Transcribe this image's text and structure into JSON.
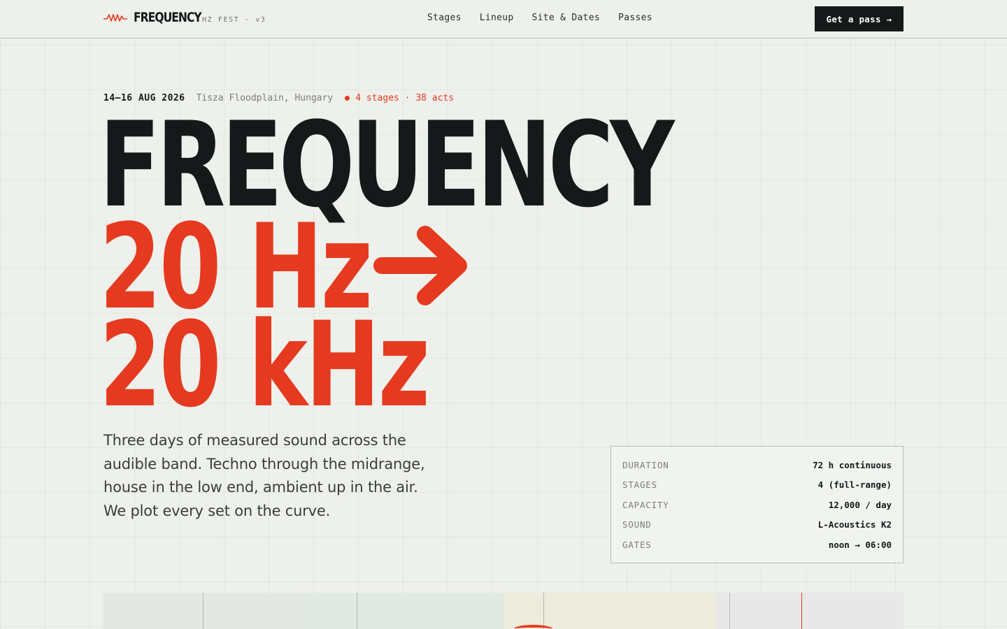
{
  "brand": {
    "name": "FREQUENCY",
    "sub": "HZ FEST · v3",
    "logo_icon": "waveform-icon",
    "accent": "#e53a1f",
    "ink": "#151919"
  },
  "nav": {
    "links": [
      "Stages",
      "Lineup",
      "Site & Dates",
      "Passes"
    ],
    "cta": "Get a pass →"
  },
  "meta": {
    "date": "14–16 AUG 2026",
    "place": "Tisza Floodplain, Hungary",
    "stats": "4 stages · 38 acts"
  },
  "hero": {
    "line1": "FREQUENCY",
    "line2": "20 Hz",
    "line3": "20 kHz",
    "arrow_icon": "arrow-right-icon"
  },
  "blurb": "Three days of measured sound across the audible band. Techno through the midrange, house in the low end, ambient up in the air. We plot every set on the curve.",
  "specs": [
    {
      "key": "DURATION",
      "value": "72 h continuous"
    },
    {
      "key": "STAGES",
      "value": "4 (full-range)"
    },
    {
      "key": "CAPACITY",
      "value": "12,000 / day"
    },
    {
      "key": "SOUND",
      "value": "L-Acoustics K2"
    },
    {
      "key": "GATES",
      "value": "noon → 06:00"
    }
  ]
}
